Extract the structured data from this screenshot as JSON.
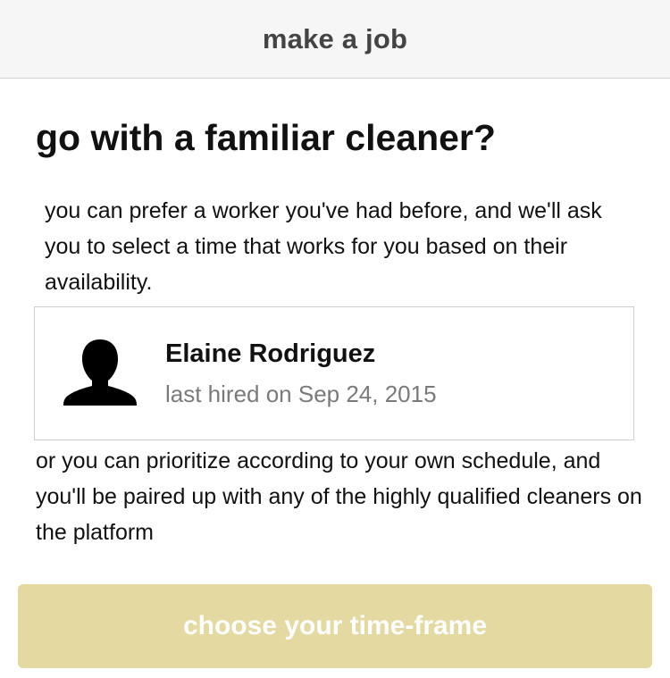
{
  "nav": {
    "title": "make a job"
  },
  "main": {
    "headline": "go with a familiar cleaner?",
    "intro": "you can prefer a worker you've had before, and we'll ask you to select a time that works for you based on their availability.",
    "worker": {
      "name": "Elaine Rodriguez",
      "meta": "last hired on Sep 24, 2015",
      "avatar_icon": "person-silhouette-icon"
    },
    "alternative": "or you can prioritize according to your own schedule, and you'll be paired up with any of the highly qualified cleaners on the platform"
  },
  "cta": {
    "label": "choose your time-frame",
    "background": "#e4d9a0",
    "text_color": "#ffffff"
  }
}
